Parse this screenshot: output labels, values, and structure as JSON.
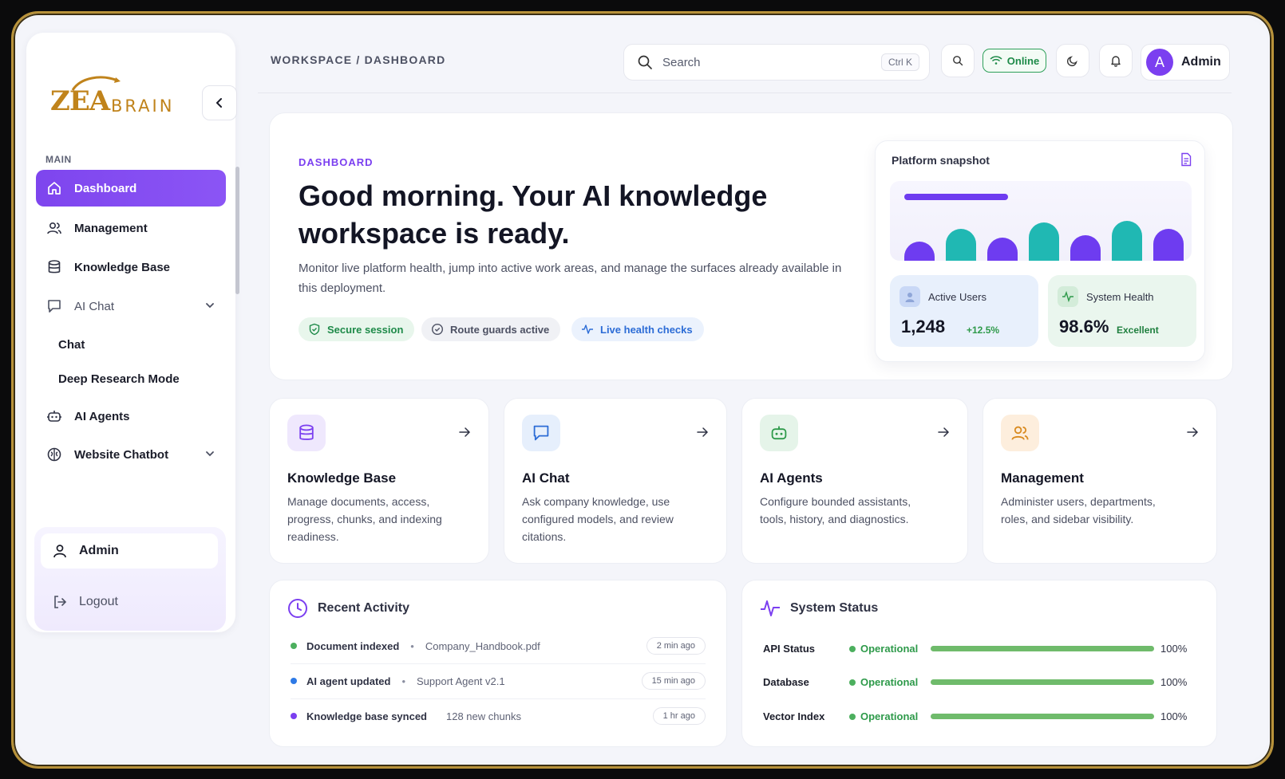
{
  "sidebar": {
    "logo_main": "ZEA",
    "logo_sub": "BRAIN",
    "section_label": "MAIN",
    "items": [
      {
        "label": "Dashboard"
      },
      {
        "label": "Management"
      },
      {
        "label": "Knowledge Base"
      },
      {
        "label": "AI Chat"
      },
      {
        "label": "AI Agents"
      },
      {
        "label": "Website Chatbot"
      }
    ],
    "ai_chat_children": [
      "Chat",
      "Deep Research Mode"
    ],
    "user_label": "Admin",
    "logout_label": "Logout"
  },
  "topbar": {
    "breadcrumb": "WORKSPACE / DASHBOARD",
    "search_placeholder": "Search",
    "search_shortcut": "Ctrl K",
    "status_label": "Online",
    "avatar_initial": "A",
    "user_label": "Admin"
  },
  "hero": {
    "eyebrow": "DASHBOARD",
    "title": "Good morning. Your AI knowledge workspace is ready.",
    "description": "Monitor live platform health, jump into active work areas, and manage the surfaces already available in this deployment.",
    "chips": [
      "Secure session",
      "Route guards active",
      "Live health checks"
    ],
    "snapshot": {
      "title": "Platform snapshot",
      "bars": [
        {
          "level": 0.42,
          "color": "#6e3cf0"
        },
        {
          "level": 0.72,
          "color": "#20b8b3"
        },
        {
          "level": 0.52,
          "color": "#6e3cf0"
        },
        {
          "level": 0.86,
          "color": "#20b8b3"
        },
        {
          "level": 0.58,
          "color": "#6e3cf0"
        },
        {
          "level": 0.9,
          "color": "#20b8b3"
        },
        {
          "level": 0.72,
          "color": "#6e3cf0"
        }
      ],
      "stats": [
        {
          "label": "Active Users",
          "value": "1,248",
          "sub": "+12.5%"
        },
        {
          "label": "System Health",
          "value": "98.6%",
          "sub": "Excellent"
        }
      ]
    }
  },
  "features": [
    {
      "title": "Knowledge Base",
      "description": "Manage documents, access, progress, chunks, and indexing readiness."
    },
    {
      "title": "AI Chat",
      "description": "Ask company knowledge, use configured models, and review citations."
    },
    {
      "title": "AI Agents",
      "description": "Configure bounded assistants, tools, history, and diagnostics."
    },
    {
      "title": "Management",
      "description": "Administer users, departments, roles, and sidebar visibility."
    }
  ],
  "recent_activity": {
    "title": "Recent Activity",
    "items": [
      {
        "name": "Document indexed",
        "detail": "Company_Handbook.pdf",
        "time": "2 min ago",
        "dot_color": "#4caf5e",
        "separator": "•"
      },
      {
        "name": "AI agent updated",
        "detail": "Support Agent v2.1",
        "time": "15 min ago",
        "dot_color": "#2e7ae6",
        "separator": "•"
      },
      {
        "name": "Knowledge base synced",
        "detail": "128 new chunks",
        "time": "1 hr ago",
        "dot_color": "#7b3ff0",
        "separator": ""
      }
    ]
  },
  "system_status": {
    "title": "System Status",
    "items": [
      {
        "name": "API Status",
        "state": "Operational",
        "level": 1.0,
        "percent": "100%"
      },
      {
        "name": "Database",
        "state": "Operational",
        "level": 1.0,
        "percent": "100%"
      },
      {
        "name": "Vector Index",
        "state": "Operational",
        "level": 1.0,
        "percent": "100%"
      }
    ]
  },
  "colors": {
    "accent": "#7b3ff0",
    "teal": "#20b8b3",
    "success": "#2e9a4a",
    "frame": "#b8923a"
  },
  "icons": {
    "nav": [
      "home-icon",
      "users-icon",
      "database-icon",
      "chat-bubble-icon",
      "bot-icon",
      "brain-icon"
    ],
    "features": [
      "database-icon",
      "chat-bubble-icon",
      "bot-icon",
      "users-icon"
    ]
  }
}
